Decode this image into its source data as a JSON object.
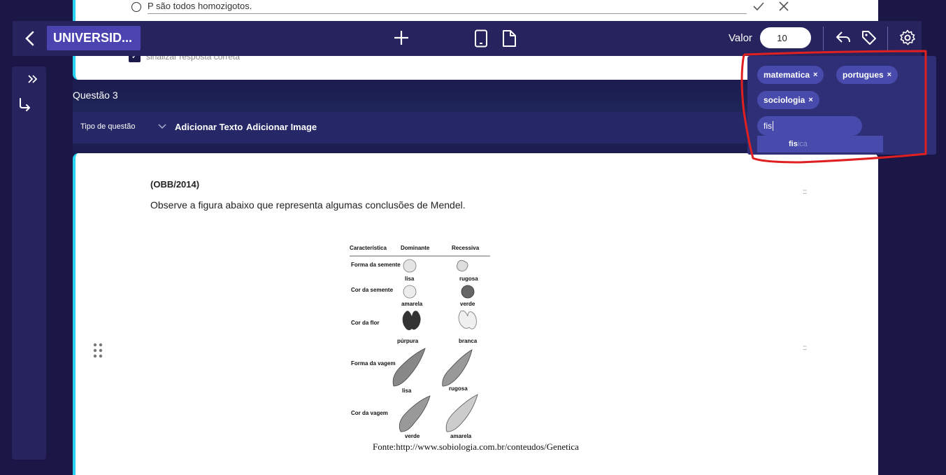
{
  "prev_question": {
    "option_text": "P são todos homozigotos.",
    "checkbox_label": "sinalizar resposta correta"
  },
  "topbar": {
    "title": "UNIVERSID...",
    "valor_label": "Valor",
    "valor_value": "10"
  },
  "question": {
    "title": "Questão 3",
    "type_label": "Tipo de questão",
    "add_text_label": "Adicionar Texto",
    "add_image_label": "Adicionar Image",
    "source": "(OBB/2014)",
    "stem": "Observe a figura abaixo que representa algumas conclusões de Mendel.",
    "figure": {
      "headers": [
        "Característica",
        "Dominante",
        "Recessiva"
      ],
      "rows": [
        {
          "characteristic": "Forma da semente",
          "dominant": "lisa",
          "recessive": "rugosa"
        },
        {
          "characteristic": "Cor da semente",
          "dominant": "amarela",
          "recessive": "verde"
        },
        {
          "characteristic": "Cor da flor",
          "dominant": "púrpura",
          "recessive": "branca"
        },
        {
          "characteristic": "Forma da vagem",
          "dominant": "lisa",
          "recessive": "rugosa"
        },
        {
          "characteristic": "Cor da vagem",
          "dominant": "verde",
          "recessive": "amarela"
        }
      ]
    },
    "caption": "Fonte:http://www.sobiologia.com.br/conteudos/Genetica"
  },
  "tags": {
    "items": [
      "matematica",
      "portugues",
      "sociologia"
    ],
    "remove_symbol": "×",
    "input_value": "fis",
    "suggestion_match": "fis",
    "suggestion_rest": "ica"
  },
  "colors": {
    "page_bg": "#1a1746",
    "bar_bg": "#26235e",
    "accent": "#27d3f0",
    "tag_bg": "#484bac",
    "highlight": "#e02020"
  }
}
